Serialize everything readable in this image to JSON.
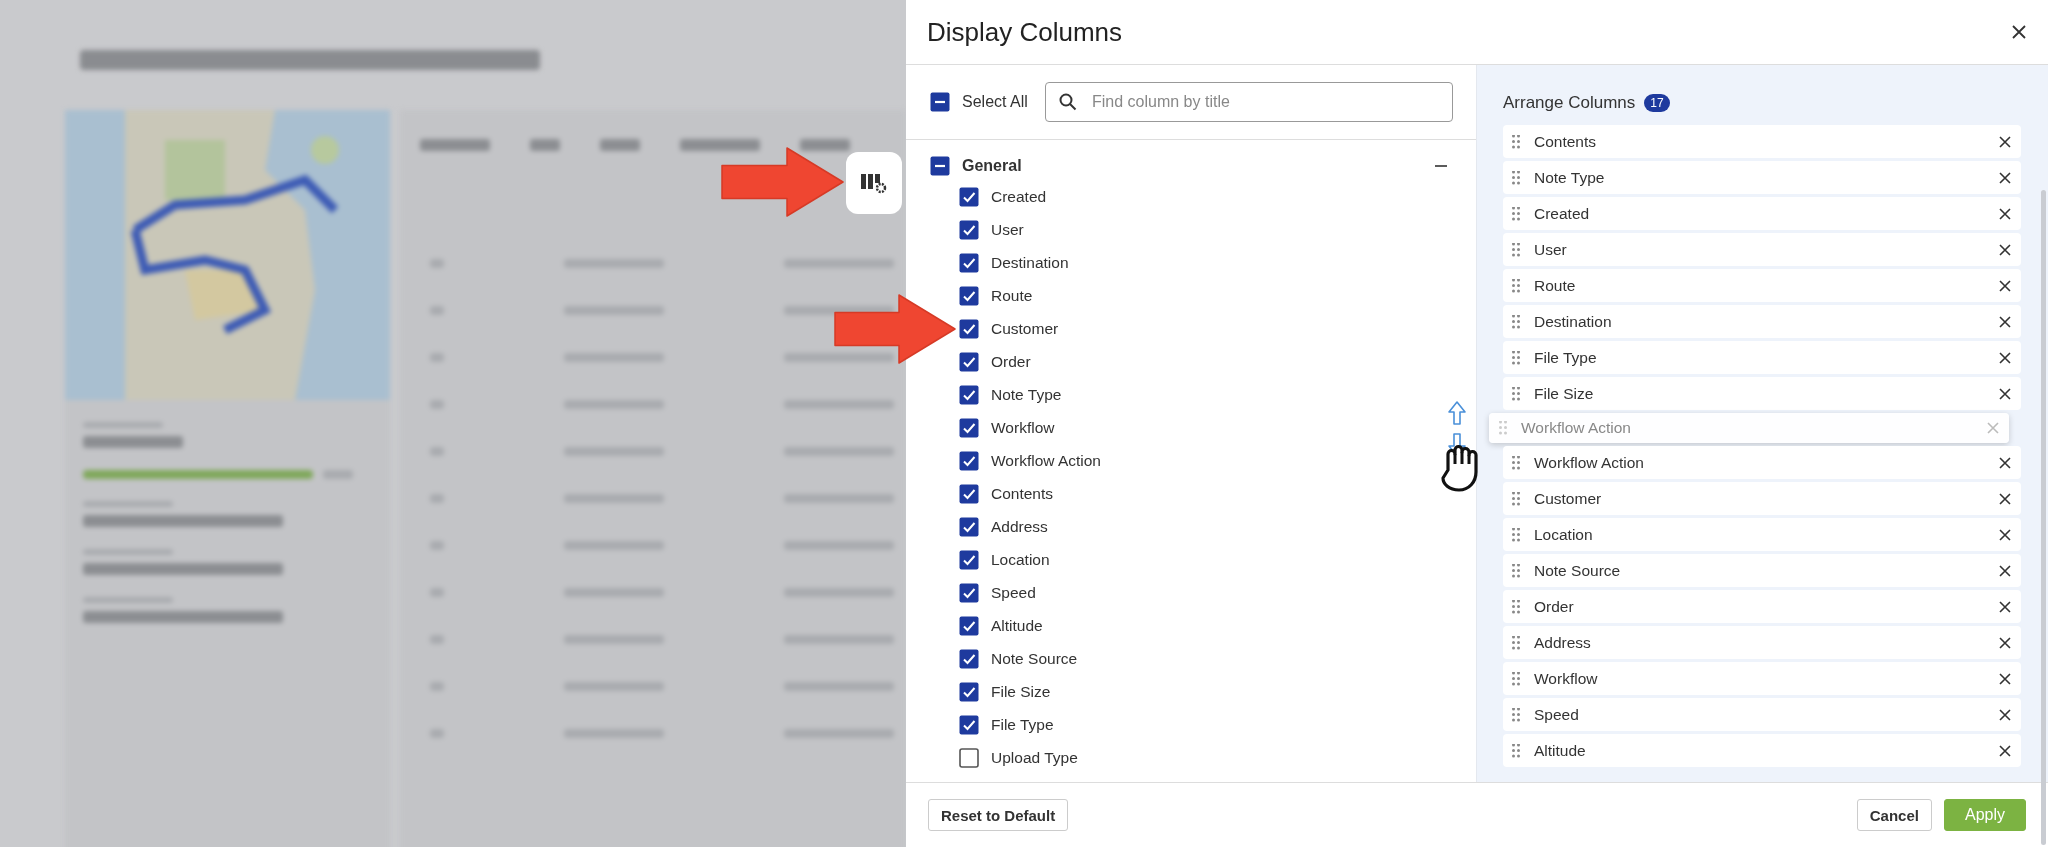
{
  "dialog": {
    "title": "Display Columns"
  },
  "select_all": {
    "label": "Select All",
    "checked": false,
    "indeterminate": true
  },
  "search": {
    "placeholder": "Find column by title"
  },
  "route_progress": {
    "level": 1
  },
  "groups": [
    {
      "label": "General",
      "checked": false,
      "indeterminate": true,
      "expanded": true,
      "items": [
        {
          "label": "Created",
          "checked": true
        },
        {
          "label": "User",
          "checked": true
        },
        {
          "label": "Destination",
          "checked": true
        },
        {
          "label": "Route",
          "checked": true
        },
        {
          "label": "Customer",
          "checked": true
        },
        {
          "label": "Order",
          "checked": true
        },
        {
          "label": "Note Type",
          "checked": true
        },
        {
          "label": "Workflow",
          "checked": true
        },
        {
          "label": "Workflow Action",
          "checked": true
        },
        {
          "label": "Contents",
          "checked": true
        },
        {
          "label": "Address",
          "checked": true
        },
        {
          "label": "Location",
          "checked": true
        },
        {
          "label": "Speed",
          "checked": true
        },
        {
          "label": "Altitude",
          "checked": true
        },
        {
          "label": "Note Source",
          "checked": true
        },
        {
          "label": "File Size",
          "checked": true
        },
        {
          "label": "File Type",
          "checked": true
        },
        {
          "label": "Upload Type",
          "checked": false
        }
      ]
    }
  ],
  "arrange": {
    "title": "Arrange Columns",
    "count": "17",
    "rows": [
      {
        "label": "Contents",
        "kind": "row"
      },
      {
        "label": "Note Type",
        "kind": "row"
      },
      {
        "label": "Created",
        "kind": "row"
      },
      {
        "label": "User",
        "kind": "row"
      },
      {
        "label": "Route",
        "kind": "row"
      },
      {
        "label": "Destination",
        "kind": "row"
      },
      {
        "label": "File Type",
        "kind": "row"
      },
      {
        "label": "File Size",
        "kind": "row"
      },
      {
        "label": "Workflow Action",
        "kind": "dragging"
      },
      {
        "label": "Workflow Action",
        "kind": "row"
      },
      {
        "label": "Customer",
        "kind": "row"
      },
      {
        "label": "Location",
        "kind": "row"
      },
      {
        "label": "Note Source",
        "kind": "row"
      },
      {
        "label": "Order",
        "kind": "row"
      },
      {
        "label": "Address",
        "kind": "row"
      },
      {
        "label": "Workflow",
        "kind": "row"
      },
      {
        "label": "Speed",
        "kind": "row"
      },
      {
        "label": "Altitude",
        "kind": "row"
      }
    ]
  },
  "buttons": [
    {
      "label": "Reset to Default",
      "kind": "secondary"
    },
    {
      "label": "Cancel",
      "kind": "secondary"
    },
    {
      "label": "Apply",
      "kind": "primary"
    }
  ]
}
